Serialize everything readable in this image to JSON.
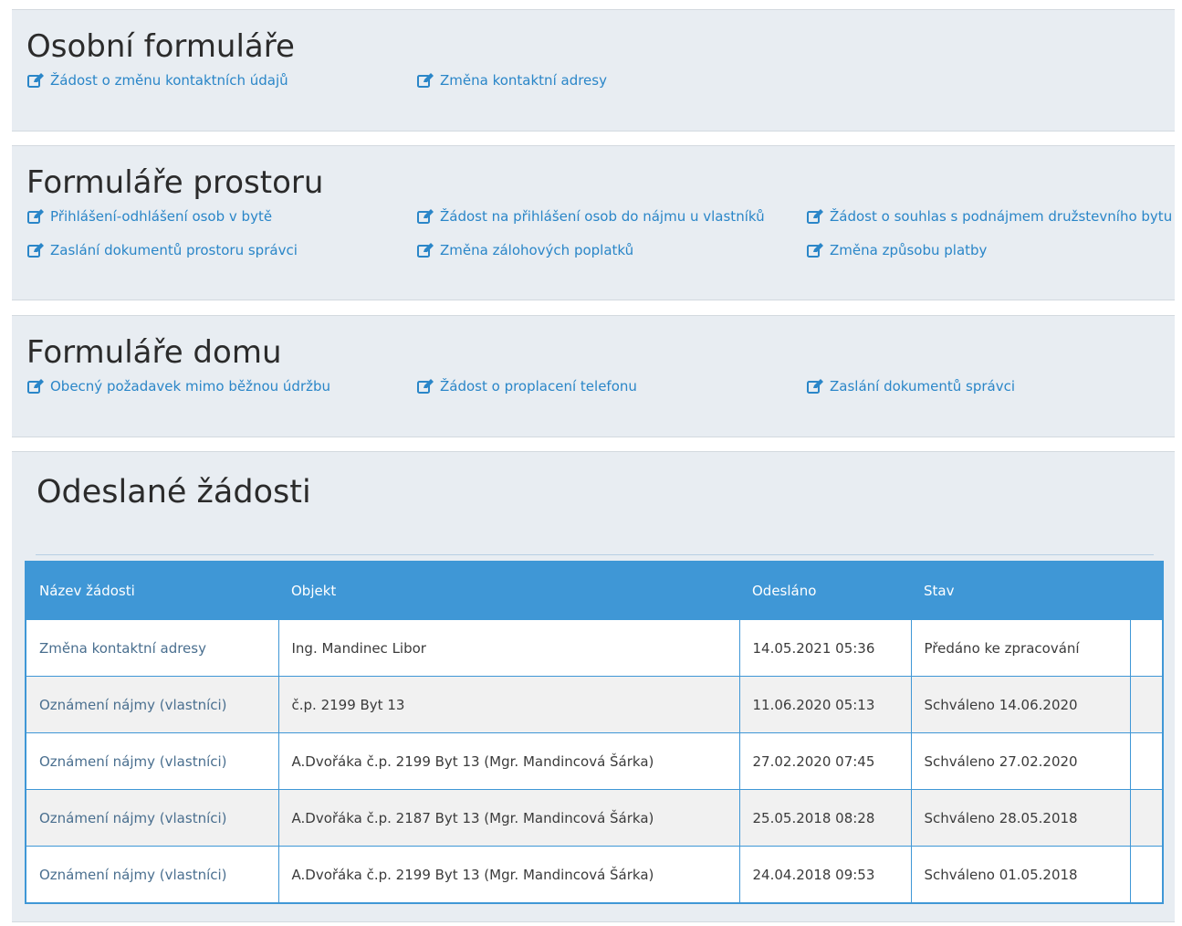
{
  "personal": {
    "title": "Osobní formuláře",
    "links": [
      {
        "label": "Žádost o změnu kontaktních údajů",
        "icon": "edit-icon"
      },
      {
        "label": "Změna kontaktní adresy",
        "icon": "edit-icon"
      }
    ]
  },
  "space": {
    "title": "Formuláře prostoru",
    "links": [
      {
        "label": "Přihlášení-odhlášení osob v bytě",
        "icon": "edit-icon"
      },
      {
        "label": "Žádost na přihlášení osob do nájmu u vlastníků",
        "icon": "edit-icon"
      },
      {
        "label": "Žádost o souhlas s podnájmem družstevního bytu",
        "icon": "edit-icon"
      },
      {
        "label": "Zaslání dokumentů prostoru správci",
        "icon": "edit-icon"
      },
      {
        "label": "Změna zálohových poplatků",
        "icon": "edit-icon"
      },
      {
        "label": "Změna způsobu platby",
        "icon": "edit-icon"
      }
    ]
  },
  "house": {
    "title": "Formuláře domu",
    "links": [
      {
        "label": "Obecný požadavek mimo běžnou údržbu",
        "icon": "edit-icon"
      },
      {
        "label": "Žádost o proplacení telefonu",
        "icon": "edit-icon"
      },
      {
        "label": "Zaslání dokumentů správci",
        "icon": "edit-icon"
      }
    ]
  },
  "sent": {
    "title": "Odeslané žádosti",
    "columns": [
      "Název žádosti",
      "Objekt",
      "Odesláno",
      "Stav"
    ],
    "rows": [
      [
        "Změna kontaktní adresy",
        "Ing. Mandinec Libor",
        "14.05.2021 05:36",
        "Předáno ke zpracování"
      ],
      [
        "Oznámení nájmy (vlastníci)",
        "č.p. 2199 Byt 13",
        "11.06.2020 05:13",
        "Schváleno 14.06.2020"
      ],
      [
        "Oznámení nájmy (vlastníci)",
        "A.Dvořáka č.p. 2199 Byt 13 (Mgr. Mandincová Šárka)",
        "27.02.2020 07:45",
        "Schváleno 27.02.2020"
      ],
      [
        "Oznámení nájmy (vlastníci)",
        "A.Dvořáka č.p. 2187 Byt 13 (Mgr. Mandincová Šárka)",
        "25.05.2018 08:28",
        "Schváleno 28.05.2018"
      ],
      [
        "Oznámení nájmy (vlastníci)",
        "A.Dvořáka č.p. 2199 Byt 13 (Mgr. Mandincová Šárka)",
        "24.04.2018 09:53",
        "Schváleno 01.05.2018"
      ]
    ]
  },
  "colors": {
    "link": "#2a86c8",
    "table_header": "#3f97d6",
    "panel_bg": "#e8edf2"
  }
}
